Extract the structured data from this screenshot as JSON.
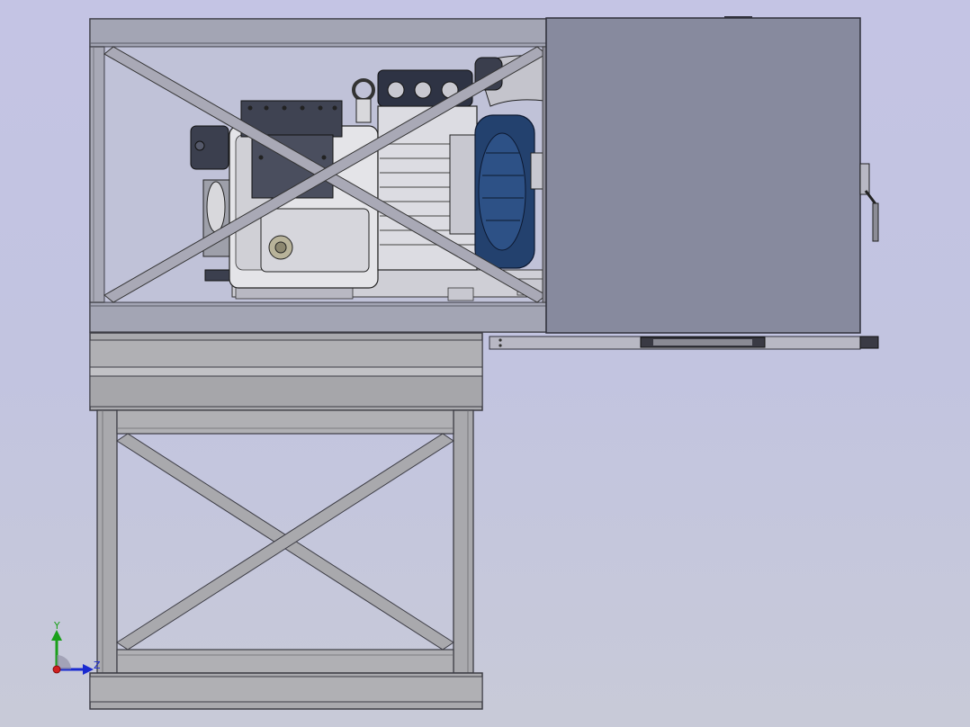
{
  "triad": {
    "y_label": "Y",
    "z_label": "Z",
    "colors": {
      "y": "#1aa01a",
      "z": "#1a2ad0",
      "x": "#d02020"
    }
  },
  "palette": {
    "frame_steel": "#a9a9ad",
    "frame_edge": "#3c3c44",
    "enclosure_panel": "#878a9e",
    "motor_blue": "#23416e"
  }
}
